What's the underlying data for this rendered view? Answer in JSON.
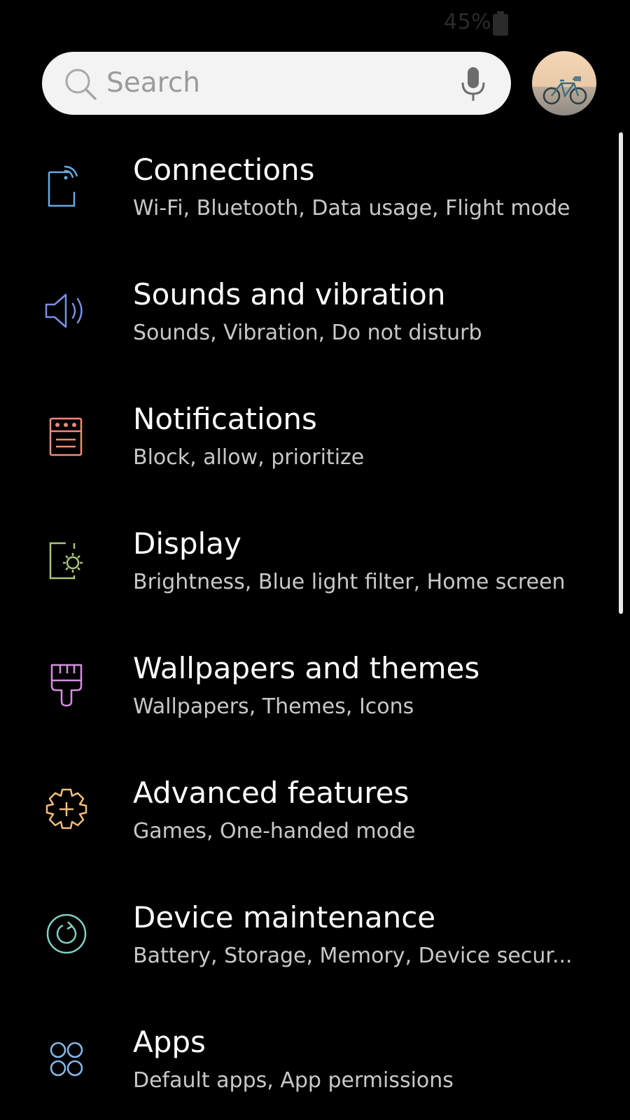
{
  "status_bar": {
    "battery_percent": "45%",
    "battery_icon": "battery-icon"
  },
  "search": {
    "placeholder": "Search",
    "icons": [
      "search-icon",
      "mic-icon"
    ]
  },
  "profile": {
    "avatar_icon": "avatar"
  },
  "colors": {
    "background": "#000000",
    "title": "#ffffff",
    "subtitle": "#c8c8c8",
    "connections": "#6aa9e0",
    "sounds": "#7b8fe8",
    "notifications": "#f08a7a",
    "display": "#a8c47a",
    "wallpapers": "#d58ee0",
    "advanced": "#f2be78",
    "maintenance": "#7fd2c4",
    "apps": "#8ab8ea"
  },
  "settings": {
    "items": [
      {
        "title": "Connections",
        "subtitle": "Wi-Fi, Bluetooth, Data usage, Flight mode",
        "icon": "connections-icon"
      },
      {
        "title": "Sounds and vibration",
        "subtitle": "Sounds, Vibration, Do not disturb",
        "icon": "speaker-icon"
      },
      {
        "title": "Notifications",
        "subtitle": "Block, allow, prioritize",
        "icon": "notifications-icon"
      },
      {
        "title": "Display",
        "subtitle": "Brightness, Blue light filter, Home screen",
        "icon": "display-icon"
      },
      {
        "title": "Wallpapers and themes",
        "subtitle": "Wallpapers, Themes, Icons",
        "icon": "paintbrush-icon"
      },
      {
        "title": "Advanced features",
        "subtitle": "Games, One-handed mode",
        "icon": "gear-plus-icon"
      },
      {
        "title": "Device maintenance",
        "subtitle": "Battery, Storage, Memory, Device secur...",
        "icon": "maintenance-icon"
      },
      {
        "title": "Apps",
        "subtitle": "Default apps, App permissions",
        "icon": "apps-grid-icon"
      }
    ]
  }
}
